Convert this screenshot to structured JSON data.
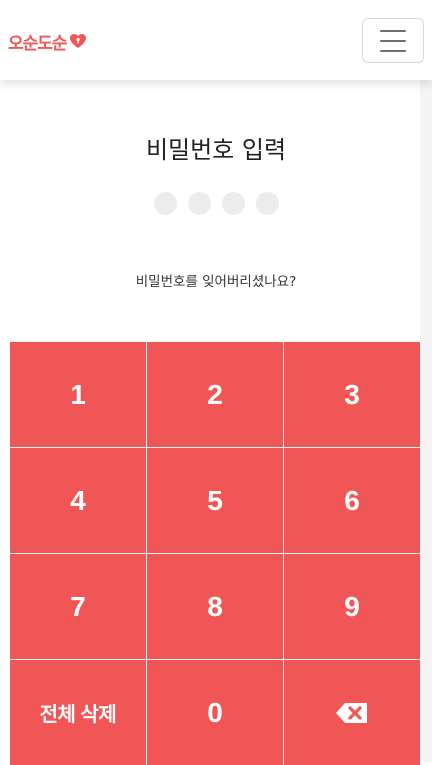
{
  "header": {
    "logo_text": "오순도순",
    "menu_icon": "hamburger-menu-icon"
  },
  "main": {
    "title": "비밀번호 입력",
    "pin_length": 4,
    "pin_entered": 0,
    "forgot_link": "비밀번호를 잊어버리셨나요?"
  },
  "keypad": {
    "keys": [
      "1",
      "2",
      "3",
      "4",
      "5",
      "6",
      "7",
      "8",
      "9",
      "전체 삭제",
      "0"
    ],
    "backspace_icon": "backspace-icon"
  },
  "colors": {
    "accent": "#f05656",
    "dot_empty": "#ececec"
  }
}
